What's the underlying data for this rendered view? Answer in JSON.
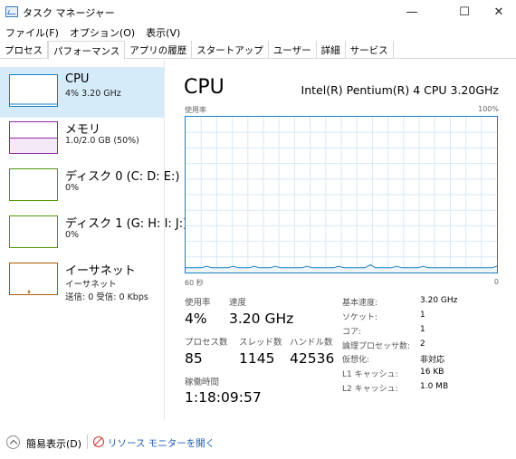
{
  "window": {
    "title": "タスク マネージャー",
    "minimize_glyph": "—",
    "maximize_glyph": "☐",
    "close_glyph": "✕"
  },
  "menu": [
    "ファイル(F)",
    "オプション(O)",
    "表示(V)"
  ],
  "tabs": [
    "プロセス",
    "パフォーマンス",
    "アプリの履歴",
    "スタートアップ",
    "ユーザー",
    "詳細",
    "サービス"
  ],
  "active_tab": "パフォーマンス",
  "sidebar": {
    "items": [
      {
        "name": "CPU",
        "sub": "4% 3.20 GHz",
        "sub2": "",
        "color": "#1a7fc0"
      },
      {
        "name": "メモリ",
        "sub": "1.0/2.0 GB (50%)",
        "sub2": "",
        "color": "#8b2e9e"
      },
      {
        "name": "ディスク 0 (C: D: E:)",
        "sub": "0%",
        "sub2": "",
        "color": "#4e9a06"
      },
      {
        "name": "ディスク 1 (G: H: I: J:)",
        "sub": "0%",
        "sub2": "",
        "color": "#4e9a06"
      },
      {
        "name": "イーサネット",
        "sub": "イーサネット",
        "sub2": "送信: 0 受信: 0 Kbps",
        "color": "#a85c00"
      }
    ]
  },
  "main": {
    "title": "CPU",
    "processor": "Intel(R) Pentium(R) 4 CPU 3.20GHz",
    "graph": {
      "y_label": "使用率",
      "y_max": "100%",
      "x_label": "60 秒",
      "x_min": "0",
      "line_color": "#1a7fc0",
      "grid_color": "#d9eaf7",
      "usage_percent": [
        3,
        3,
        3,
        3,
        4,
        3,
        3,
        3,
        3,
        4,
        3,
        3,
        3,
        4,
        3,
        3,
        3,
        4,
        3,
        3,
        3,
        3,
        3,
        4,
        3,
        3,
        3,
        3,
        3,
        4,
        3,
        3,
        3,
        3,
        3,
        5,
        3,
        3,
        3,
        3,
        4,
        3,
        3,
        3,
        3,
        4,
        3,
        3,
        3,
        3,
        3,
        3,
        3,
        3,
        3,
        3,
        3,
        3,
        3,
        4
      ]
    },
    "stats": {
      "usage_label": "使用率",
      "usage_value": "4%",
      "speed_label": "速度",
      "speed_value": "3.20 GHz",
      "processes_label": "プロセス数",
      "processes_value": "85",
      "threads_label": "スレッド数",
      "threads_value": "1145",
      "handles_label": "ハンドル数",
      "handles_value": "42536",
      "uptime_label": "稼働時間",
      "uptime_value": "1:18:09:57"
    },
    "info": [
      {
        "label": "基本速度:",
        "value": "3.20 GHz"
      },
      {
        "label": "ソケット:",
        "value": "1"
      },
      {
        "label": "コア:",
        "value": "1"
      },
      {
        "label": "論理プロセッサ数:",
        "value": "2"
      },
      {
        "label": "仮想化:",
        "value": "非対応"
      },
      {
        "label": "L1 キャッシュ:",
        "value": "16 KB"
      },
      {
        "label": "L2 キャッシュ:",
        "value": "1.0 MB"
      }
    ]
  },
  "footer": {
    "fewer_details": "簡易表示(D)",
    "resource_monitor": "リソース モニターを開く"
  }
}
